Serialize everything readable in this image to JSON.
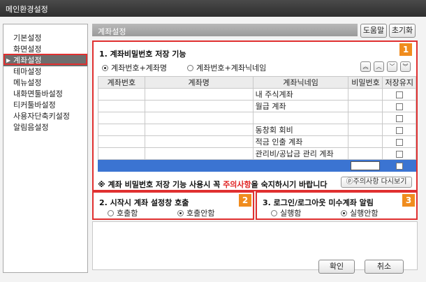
{
  "window": {
    "title": "메인환경설정"
  },
  "sidebar": {
    "items": [
      {
        "label": "기본설정"
      },
      {
        "label": "화면설정"
      },
      {
        "label": "계좌설정",
        "selected": true
      },
      {
        "label": "테마설정"
      },
      {
        "label": "메뉴설정"
      },
      {
        "label": "내화면툴바설정"
      },
      {
        "label": "티커툴바설정"
      },
      {
        "label": "사용자단축키설정"
      },
      {
        "label": "알림음설정"
      }
    ]
  },
  "header": {
    "title": "계좌설정",
    "help_label": "도움말",
    "reset_label": "초기화"
  },
  "section1": {
    "badge": "1",
    "title": "1. 계좌비밀번호 저장 기능",
    "options": [
      "계좌번호+계좌명",
      "계좌번호+계좌닉네임"
    ],
    "selected_option": 0,
    "nav_icons": [
      "double-up-icon",
      "up-icon",
      "down-icon",
      "double-down-icon"
    ],
    "table": {
      "columns": [
        "계좌번호",
        "계좌명",
        "계좌닉네임",
        "비밀번호",
        "저장유지"
      ],
      "rows": [
        {
          "nickname": "내 주식계좌"
        },
        {
          "nickname": "월급 계좌"
        },
        {
          "nickname": ""
        },
        {
          "nickname": "동창회 회비"
        },
        {
          "nickname": "적금 인출 계좌"
        },
        {
          "nickname": "관리비/공납금 관리 계좌"
        }
      ],
      "selected_row_color": "#3b74d2"
    },
    "warning_prefix": "※ 계좌 비밀번호 저장 기능 사용시 꼭 ",
    "warning_highlight": "주의사항",
    "warning_suffix": "을 숙지하시기 바랍니다",
    "reshow_label": "ⓟ주의사항 다시보기"
  },
  "section2": {
    "badge": "2",
    "title": "2. 시작시 계좌 설정창 호출",
    "options": [
      "호출함",
      "호출안함"
    ],
    "selected_option": 1
  },
  "section3": {
    "badge": "3",
    "title": "3. 로그인/로그아웃 미수계좌 알림",
    "options": [
      "실행함",
      "실행안함"
    ],
    "selected_option": 1
  },
  "footer": {
    "ok_label": "확인",
    "cancel_label": "취소"
  },
  "colors": {
    "highlight_border": "#e03030",
    "badge": "#f08c1e",
    "warning": "#e02020"
  }
}
